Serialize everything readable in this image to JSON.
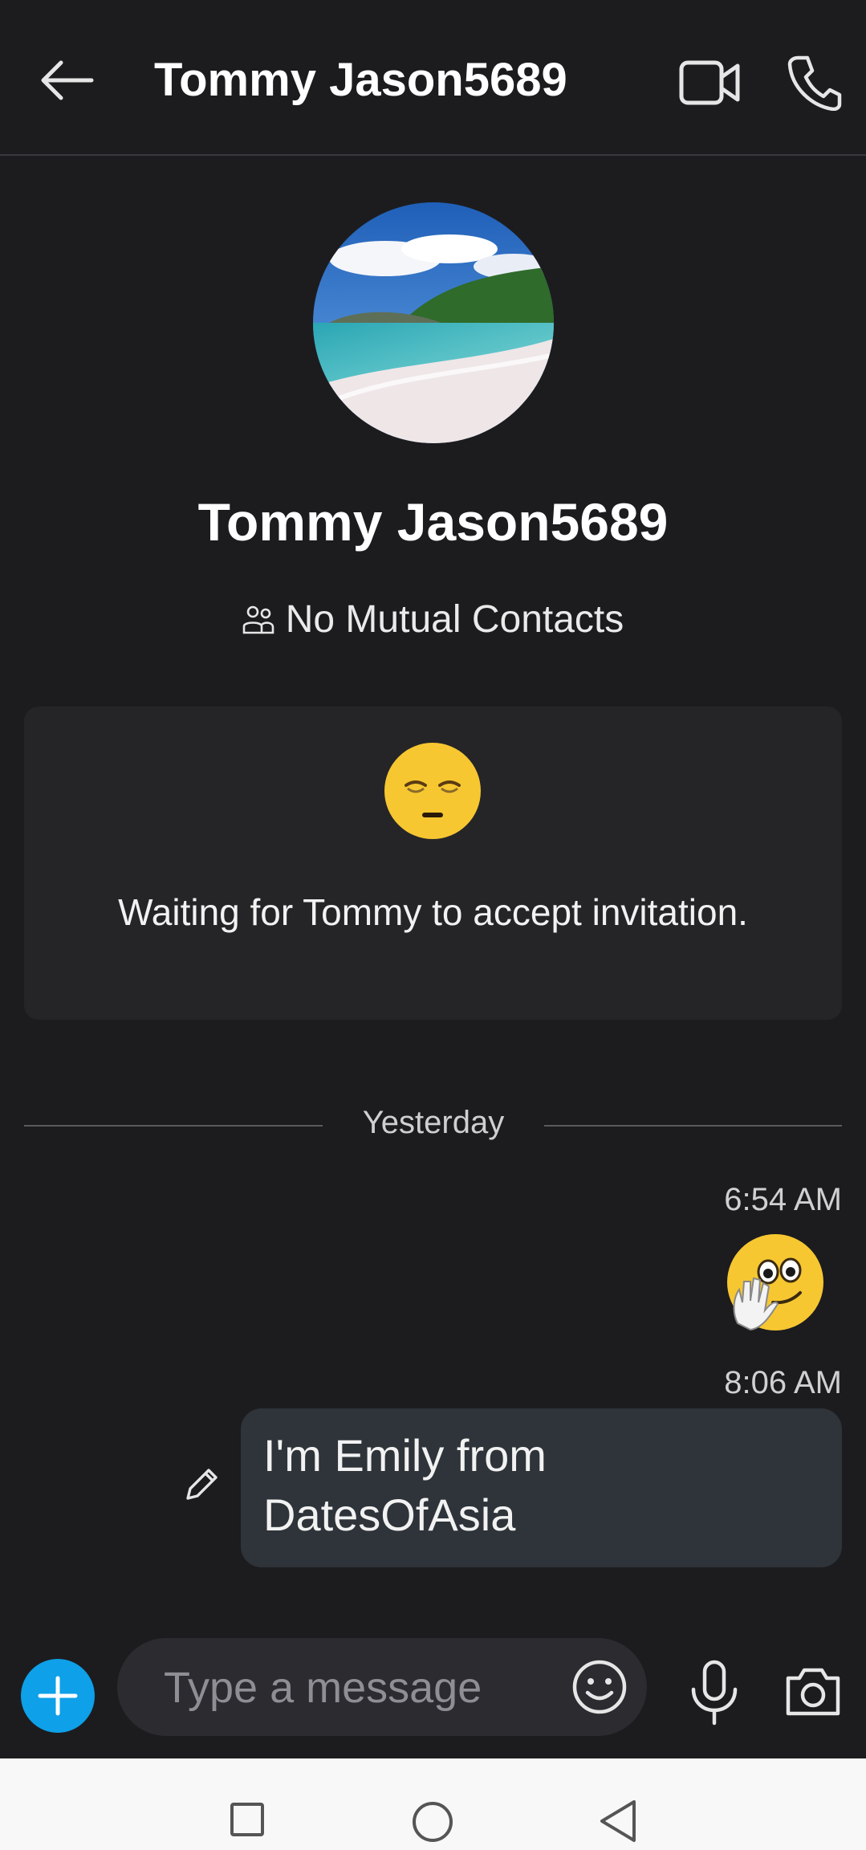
{
  "header": {
    "title": "Tommy Jason5689",
    "icons": {
      "back": "back-arrow-icon",
      "video": "video-call-icon",
      "call": "phone-icon"
    }
  },
  "profile": {
    "name": "Tommy Jason5689",
    "mutual_contacts": "No Mutual Contacts",
    "avatar": "beach-photo"
  },
  "invitation": {
    "emoji": "relieved-face-emoji",
    "text": "Waiting for Tommy to accept invitation."
  },
  "conversation": {
    "date_divider": "Yesterday",
    "messages": [
      {
        "time": "6:54 AM",
        "type": "emoji",
        "emoji": "wave-face-emoji"
      },
      {
        "time": "8:06 AM",
        "type": "text",
        "text": "I'm Emily from DatesOfAsia"
      }
    ]
  },
  "composer": {
    "placeholder": "Type a message"
  },
  "colors": {
    "background": "#1c1c1f",
    "accent": "#0ea0e8",
    "bubble": "#2e3439"
  }
}
